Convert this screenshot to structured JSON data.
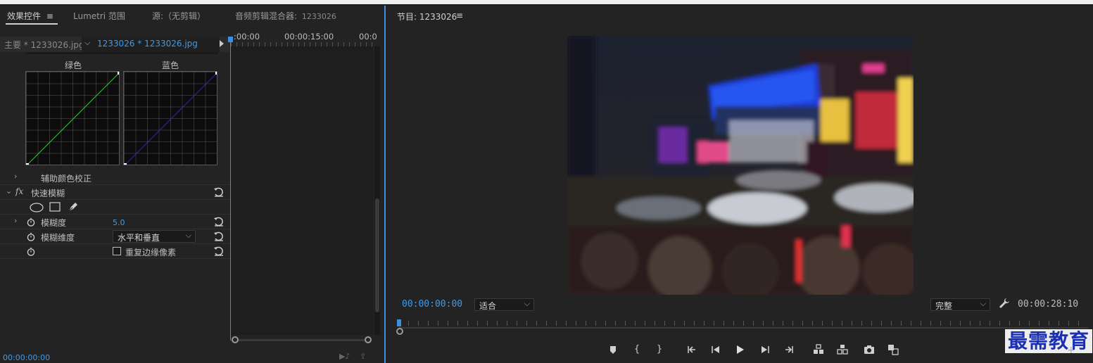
{
  "left_panel": {
    "tabs": {
      "effect_controls": "效果控件",
      "effect_controls_menu": "≡",
      "lumetri_scopes": "Lumetri 范围",
      "source": "源:（无剪辑）",
      "audio_mixer": "音频剪辑混合器:",
      "audio_mixer_seq": "1233026"
    },
    "clipbar": {
      "master": "主要 * 1233026.jpg",
      "sequence_clip": "1233026 * 1233026.jpg"
    },
    "timeline": {
      "t0": ":00:00",
      "t1": "00:00:15:00",
      "t2": "00:0"
    },
    "curves": {
      "green_label": "绿色",
      "blue_label": "蓝色",
      "green_color": "#3ec23e",
      "blue_color": "#2a2ad0"
    },
    "rows": {
      "secondary_correction": "辅助颜色校正",
      "fast_blur": "快速模糊",
      "fx": "fx",
      "blurriness_label": "模糊度",
      "blurriness_value": "5.0",
      "blur_dimensions_label": "模糊维度",
      "blur_dimensions_value": "水平和垂直",
      "repeat_edge_pixels": "重复边缘像素"
    },
    "bottom_time": "00:00:00:00"
  },
  "program": {
    "title": "节目: 1233026",
    "menu": "≡",
    "current_time": "00:00:00:00",
    "zoom": "适合",
    "quality": "完整",
    "duration": "00:00:28:10",
    "accent": "#3f9bea"
  },
  "watermark": "最需教育"
}
